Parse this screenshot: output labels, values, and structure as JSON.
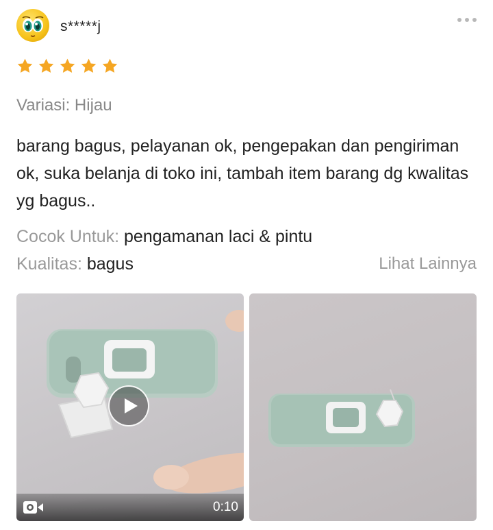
{
  "reviewer": {
    "username": "s*****j"
  },
  "rating": {
    "stars": 5,
    "max": 5,
    "color": "#f5a623"
  },
  "variation": "Variasi: Hijau",
  "review_text": "barang bagus, pelayanan ok, pengepakan dan pengiriman ok, suka belanja di toko ini, tambah item barang dg kwalitas yg bagus..",
  "attributes": [
    {
      "label": "Cocok Untuk:",
      "value": "pengamanan laci & pintu"
    },
    {
      "label": "Kualitas:",
      "value": "bagus"
    }
  ],
  "see_more": "Lihat Lainnya",
  "media": {
    "video": {
      "duration": "0:10",
      "icon": "video-camera-icon",
      "play_icon": "play-icon"
    },
    "photo": {
      "icon": "photo"
    }
  }
}
